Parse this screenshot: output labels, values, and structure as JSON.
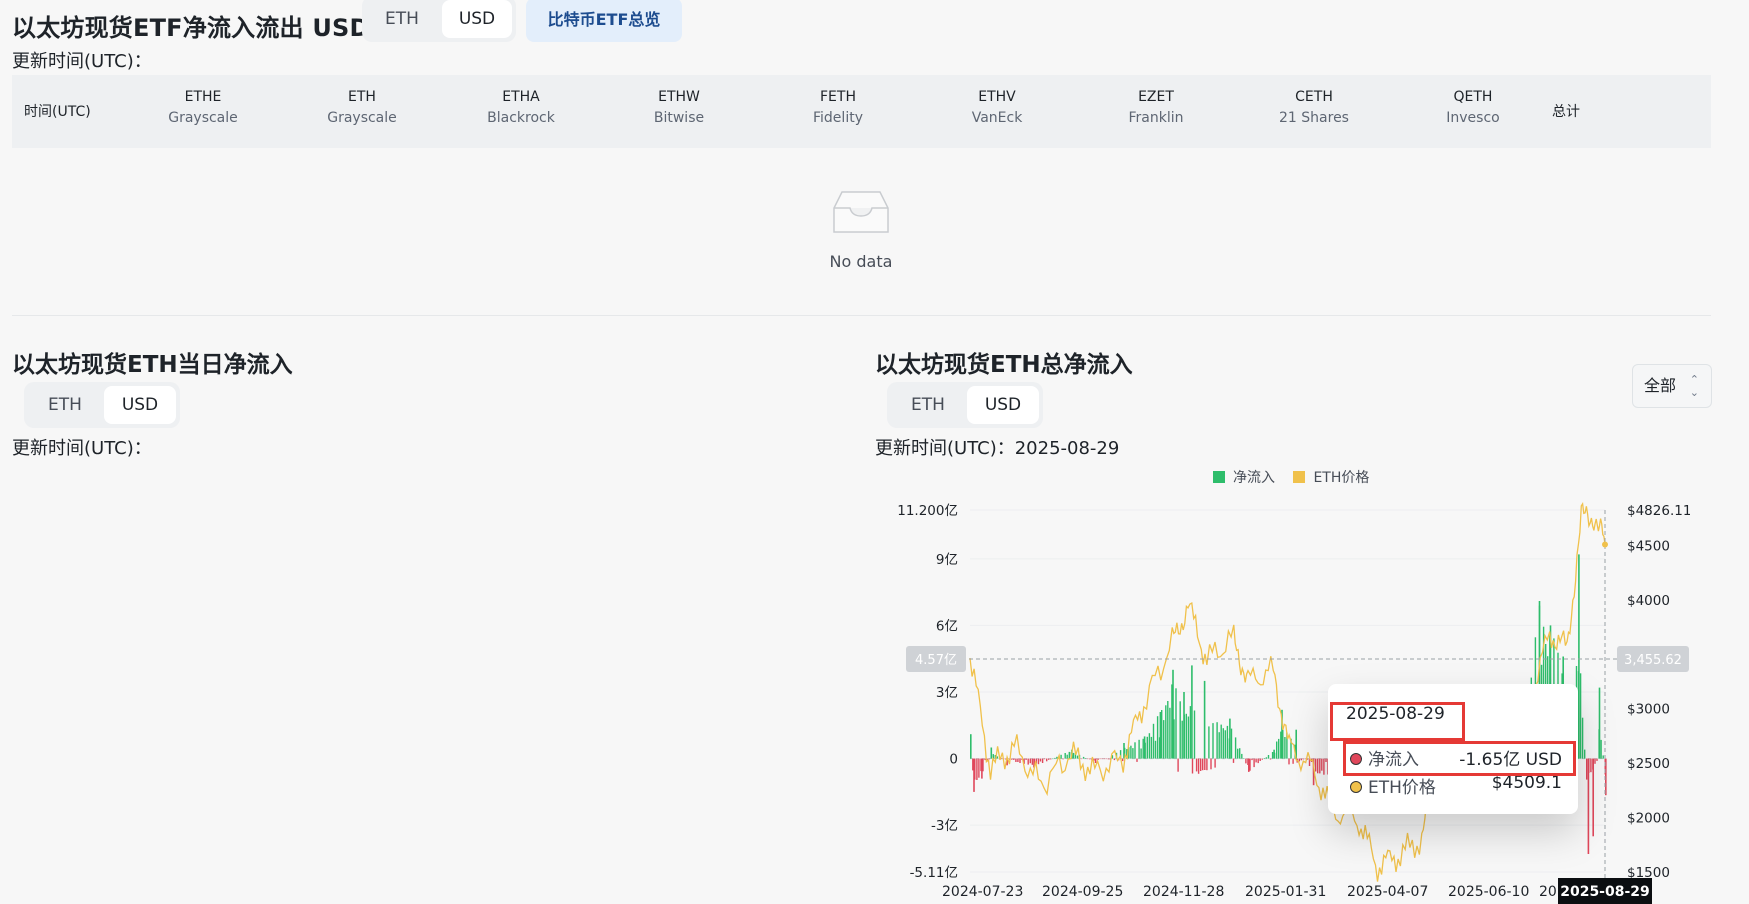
{
  "header": {
    "title": "以太坊现货ETF净流入流出 USD",
    "units": [
      "ETH",
      "USD"
    ],
    "active_unit": "USD",
    "btc_button": "比特币ETF总览",
    "updated_label": "更新时间(UTC)："
  },
  "table": {
    "time_col": "时间(UTC)",
    "columns": [
      {
        "ticker": "ETHE",
        "issuer": "Grayscale"
      },
      {
        "ticker": "ETH",
        "issuer": "Grayscale"
      },
      {
        "ticker": "ETHA",
        "issuer": "Blackrock"
      },
      {
        "ticker": "ETHW",
        "issuer": "Bitwise"
      },
      {
        "ticker": "FETH",
        "issuer": "Fidelity"
      },
      {
        "ticker": "ETHV",
        "issuer": "VanEck"
      },
      {
        "ticker": "EZET",
        "issuer": "Franklin"
      },
      {
        "ticker": "CETH",
        "issuer": "21 Shares"
      },
      {
        "ticker": "QETH",
        "issuer": "Invesco"
      }
    ],
    "total_col": "总计",
    "empty_text": "No data"
  },
  "daily": {
    "title": "以太坊现货ETH当日净流入",
    "units": [
      "ETH",
      "USD"
    ],
    "active_unit": "USD",
    "updated_label": "更新时间(UTC)："
  },
  "total": {
    "title": "以太坊现货ETH总净流入",
    "units": [
      "ETH",
      "USD"
    ],
    "active_unit": "USD",
    "updated_label": "更新时间(UTC)：2025-08-29",
    "range_select": "全部"
  },
  "chart_data": {
    "type": "bar",
    "legend": [
      "净流入",
      "ETH价格"
    ],
    "colors": {
      "inflow": "#2ebd6b",
      "outflow": "#e0475b",
      "price": "#f0c14b"
    },
    "y_left_ticks": [
      "11.200亿",
      "9亿",
      "6亿",
      "3亿",
      "0",
      "-3亿",
      "-5.11亿"
    ],
    "y_left_range": [
      -5.11,
      11.2
    ],
    "y_right_ticks": [
      "$4826.113",
      "$4500",
      "$4000",
      "$3500",
      "$3000",
      "$2500",
      "$2000",
      "$1500"
    ],
    "y_right_range": [
      1500,
      4826.113
    ],
    "x_ticks": [
      "2024-07-23",
      "2024-09-25",
      "2024-11-28",
      "2025-01-31",
      "2025-04-07",
      "2025-06-10",
      "20"
    ],
    "x_range": [
      "2024-07-23",
      "2025-08-29"
    ],
    "crosshair_left": "4.57亿",
    "crosshair_right": "3,455.62",
    "crosshair_x": "2025-08-29",
    "price_series": [
      [
        "2024-07-23",
        3480
      ],
      [
        "2024-08-05",
        2450
      ],
      [
        "2024-08-20",
        2650
      ],
      [
        "2024-09-06",
        2300
      ],
      [
        "2024-09-25",
        2580
      ],
      [
        "2024-10-10",
        2420
      ],
      [
        "2024-10-28",
        2550
      ],
      [
        "2024-11-10",
        3050
      ],
      [
        "2024-11-28",
        3600
      ],
      [
        "2024-12-08",
        3950
      ],
      [
        "2024-12-20",
        3450
      ],
      [
        "2025-01-06",
        3650
      ],
      [
        "2025-01-15",
        3250
      ],
      [
        "2025-01-31",
        3350
      ],
      [
        "2025-02-10",
        2650
      ],
      [
        "2025-02-25",
        2450
      ],
      [
        "2025-03-10",
        2050
      ],
      [
        "2025-03-25",
        2000
      ],
      [
        "2025-04-07",
        1550
      ],
      [
        "2025-04-20",
        1650
      ],
      [
        "2025-05-05",
        1800
      ],
      [
        "2025-05-15",
        2550
      ],
      [
        "2025-06-01",
        2600
      ],
      [
        "2025-06-10",
        2750
      ],
      [
        "2025-06-22",
        2250
      ],
      [
        "2025-07-10",
        2950
      ],
      [
        "2025-07-25",
        3700
      ],
      [
        "2025-08-05",
        3550
      ],
      [
        "2025-08-14",
        4750
      ],
      [
        "2025-08-22",
        4780
      ],
      [
        "2025-08-29",
        4509.1
      ]
    ],
    "flow_series": [
      [
        "2024-07-23",
        1.1
      ],
      [
        "2024-07-25",
        -1.5
      ],
      [
        "2024-07-30",
        -0.9
      ],
      [
        "2024-08-05",
        0.5
      ],
      [
        "2024-08-15",
        -0.3
      ],
      [
        "2024-09-01",
        -0.4
      ],
      [
        "2024-09-25",
        0.4
      ],
      [
        "2024-10-10",
        -0.2
      ],
      [
        "2024-10-28",
        0.7
      ],
      [
        "2024-11-10",
        1.0
      ],
      [
        "2024-11-20",
        2.1
      ],
      [
        "2024-11-28",
        4.0
      ],
      [
        "2024-12-05",
        3.0
      ],
      [
        "2024-12-10",
        4.2
      ],
      [
        "2024-12-18",
        3.5
      ],
      [
        "2025-01-03",
        1.8
      ],
      [
        "2025-01-15",
        -0.6
      ],
      [
        "2025-01-31",
        0.4
      ],
      [
        "2025-02-05",
        2.2
      ],
      [
        "2025-02-14",
        1.3
      ],
      [
        "2025-02-25",
        -1.2
      ],
      [
        "2025-03-10",
        -0.7
      ],
      [
        "2025-05-05",
        0.3
      ],
      [
        "2025-06-10",
        1.2
      ],
      [
        "2025-07-10",
        2.4
      ],
      [
        "2025-07-18",
        7.1
      ],
      [
        "2025-07-25",
        6.0
      ],
      [
        "2025-08-02",
        4.6
      ],
      [
        "2025-08-07",
        -0.9
      ],
      [
        "2025-08-12",
        9.2
      ],
      [
        "2025-08-18",
        -4.3
      ],
      [
        "2025-08-21",
        -3.5
      ],
      [
        "2025-08-25",
        3.2
      ],
      [
        "2025-08-29",
        -1.65
      ]
    ]
  },
  "tooltip": {
    "date": "2025-08-29",
    "net_label": "净流入",
    "net_value": "-1.65亿 USD",
    "price_label": "ETH价格",
    "price_value": "$4509.1"
  }
}
